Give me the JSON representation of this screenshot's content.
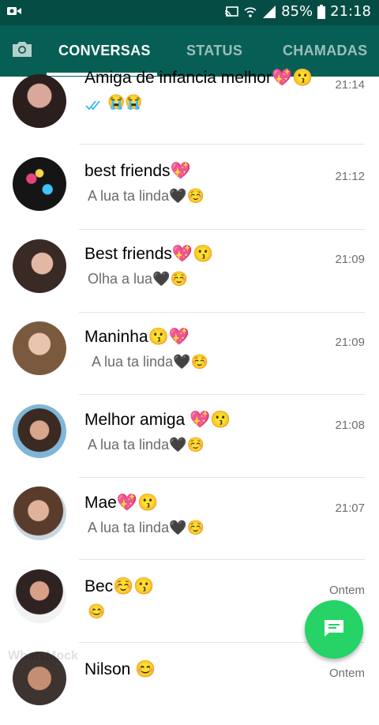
{
  "status_bar": {
    "battery": "85%",
    "time": "21:18",
    "icons": [
      "video-icon",
      "cast-icon",
      "wifi-icon",
      "signal-icon",
      "battery-icon"
    ]
  },
  "tabs": [
    {
      "label": "CONVERSAS",
      "active": true
    },
    {
      "label": "STATUS",
      "active": false
    },
    {
      "label": "CHAMADAS",
      "active": false
    }
  ],
  "chats": [
    {
      "name": "Amiga de infancia melhor💖😗",
      "time": "21:14",
      "message": "😭😭",
      "read_ticks": true
    },
    {
      "name": "best friends💖",
      "time": "21:12",
      "message": "A lua ta linda🖤☺️"
    },
    {
      "name": "Best friends💖😗",
      "time": "21:09",
      "message": "Olha a lua🖤☺️"
    },
    {
      "name": "Maninha😗💖",
      "time": "21:09",
      "message": "A lua ta linda🖤☺️"
    },
    {
      "name": "Melhor amiga 💖😗",
      "time": "21:08",
      "message": "A lua ta linda🖤☺️"
    },
    {
      "name": "Mae💖😗",
      "time": "21:07",
      "message": "A lua ta linda🖤☺️"
    },
    {
      "name": "Bec☺️😗",
      "time": "Ontem",
      "message": "😊"
    },
    {
      "name": "Nilson 😊",
      "time": "Ontem",
      "message": ""
    }
  ],
  "watermark": "WhatsMock",
  "colors": {
    "status_bar": "#054d44",
    "app_bar": "#075e54",
    "fab": "#25d366",
    "tick": "#34b7f1"
  }
}
